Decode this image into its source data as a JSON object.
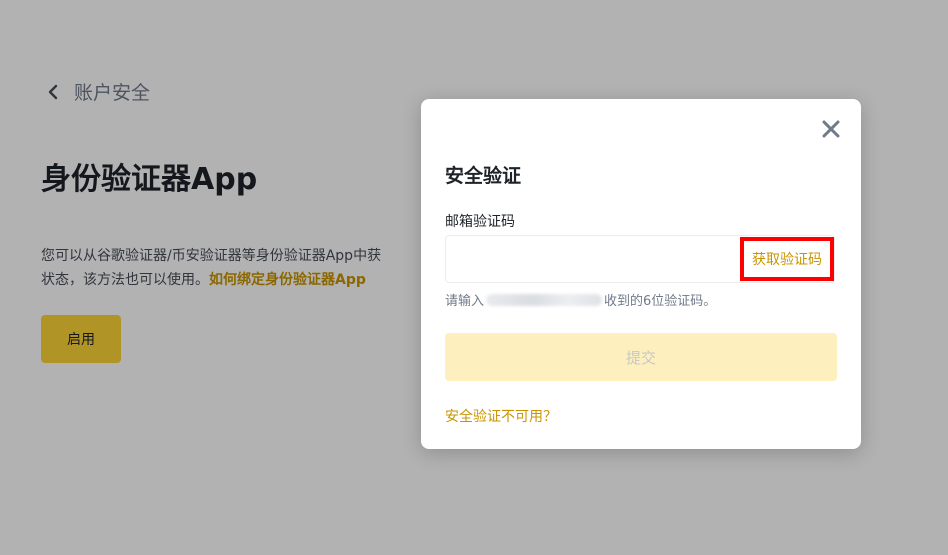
{
  "header": {
    "back_icon": "chevron-left-icon",
    "back_label": "账户安全"
  },
  "main": {
    "title": "身份验证器App",
    "description_line1": "您可以从谷歌验证器/币安验证器等身份验证器App中获",
    "description_line2": "状态，该方法也可以使用。",
    "help_link": "如何绑定身份验证器App",
    "enable_button": "启用"
  },
  "modal": {
    "close_icon": "close-icon",
    "title": "安全验证",
    "field_label": "邮箱验证码",
    "code_input_value": "",
    "get_code_button": "获取验证码",
    "hint_prefix": "请输入",
    "hint_suffix": "收到的6位验证码。",
    "submit_button": "提交",
    "unavailable_link": "安全验证不可用？"
  },
  "colors": {
    "brand_yellow": "#fcd535",
    "link_gold": "#c99400",
    "highlight_red": "#ff0000"
  }
}
